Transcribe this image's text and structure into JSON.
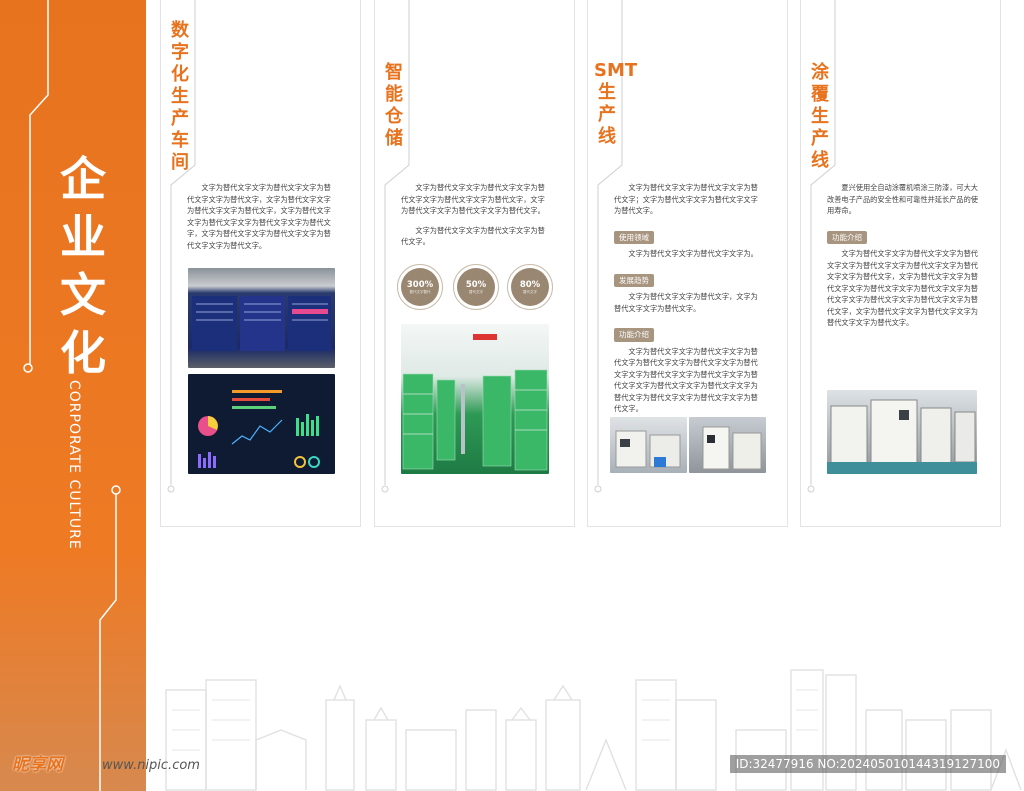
{
  "brand_color": "#e8731f",
  "accent_tag_color": "#a89580",
  "main": {
    "title": "企业文化",
    "subtitle_en": "CORPORATE CULTURE"
  },
  "cards": [
    {
      "title": "数字化生产车间",
      "paragraphs": [
        "文字为替代文字文字为替代文字文字为替代文字文字为替代文字，文字为替代文字文字为替代文字文字为替代文字，文字为替代文字文字为替代文字文字为替代文字文字为替代文字，文字为替代文字文字为替代文字文字为替代文字文字为替代文字。"
      ],
      "photos": [
        "monitoring-dashboard-wall",
        "data-visualization-dashboard"
      ]
    },
    {
      "title": "智能仓储",
      "paragraphs": [
        "文字为替代文字文字为替代文字文字为替代文字文字为替代文字文字为替代文字，文字为替代文字文字为替代文字文字为替代文字。",
        "文字为替代文字文字为替代文字文字为替代文字。"
      ],
      "stats": [
        {
          "value": "300%",
          "sub": "替代文字替代"
        },
        {
          "value": "50%",
          "sub": "替代文字"
        },
        {
          "value": "80%",
          "sub": "替代文字"
        }
      ],
      "photos": [
        "smart-warehouse-shelves"
      ]
    },
    {
      "title": "SMT生产线",
      "intro": "文字为替代文字文字为替代文字文字为替代文字；文字为替代文字文字为替代文字文字为替代文字。",
      "sections": [
        {
          "tag": "使用领域",
          "text": "文字为替代文字文字为替代文字文字为。"
        },
        {
          "tag": "发展趋势",
          "text": "文字为替代文字文字为替代文字，文字为替代文字文字为替代文字。"
        },
        {
          "tag": "功能介绍",
          "text": "文字为替代文字文字为替代文字文字为替代文字为替代文字文字为替代文字文字为替代文字文字为替代文字文字为替代文字文字为替代文字文字为替代文字文字为替代文字文字为替代文字为替代文字文字为替代文字文字为替代文字。"
        }
      ],
      "photos": [
        "smt-machine-1",
        "smt-machine-2"
      ]
    },
    {
      "title": "涂覆生产线",
      "intro": "夏兴使用全自动涂覆机喷涂三防漆，可大大改善电子产品的安全性和可靠性并延长产品的使用寿命。",
      "sections": [
        {
          "tag": "功能介绍",
          "text": "文字为替代文字文字为替代文字文字为替代文字文字为替代文字文字为替代文字文字为替代文字文字为替代文字，文字为替代文字文字为替代文字文字为替代文字文字为替代文字文字为替代文字文字为替代文字文字为替代文字文字为替代文字，文字为替代文字文字为替代文字文字为替代文字文字为替代文字。"
        }
      ],
      "photos": [
        "coating-production-line"
      ]
    }
  ],
  "watermark": {
    "logo": "昵享网",
    "url": "www.nipic.com",
    "id": "ID:32477916 NO:20240501014431912710​0"
  }
}
